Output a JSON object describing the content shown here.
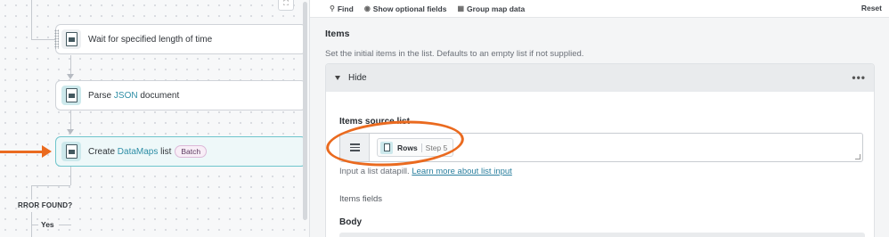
{
  "canvas": {
    "steps": [
      {
        "name": "wait",
        "text": "Wait for specified length of time"
      },
      {
        "name": "parse",
        "prefix": "Parse ",
        "highlight": "JSON",
        "suffix": " document"
      },
      {
        "name": "create",
        "prefix": "Create ",
        "highlight": "DataMaps",
        "suffix": " list",
        "badge": "Batch"
      }
    ],
    "error_label": "RROR FOUND?",
    "yes_label": "Yes"
  },
  "toolbar": {
    "find": "Find",
    "show_optional": "Show optional fields",
    "group_map": "Group map data",
    "reset": "Reset"
  },
  "items": {
    "title": "Items",
    "description": "Set the initial items in the list. Defaults to an empty list if not supplied.",
    "toggle_label": "Hide",
    "source_label": "Items source list",
    "pill": {
      "name": "Rows",
      "step": "Step 5"
    },
    "hint_prefix": "Input a list datapill. ",
    "hint_link": "Learn more about list input",
    "fields_title": "Items fields",
    "body_label": "Body"
  },
  "colors": {
    "accent": "#2e8ea6",
    "annotation": "#ea6a1f",
    "active_step": "#6fc5cc"
  },
  "icons": [
    "search-icon",
    "eye-icon",
    "group-map-icon",
    "list-input-icon",
    "more-icon",
    "caret-down-icon"
  ]
}
